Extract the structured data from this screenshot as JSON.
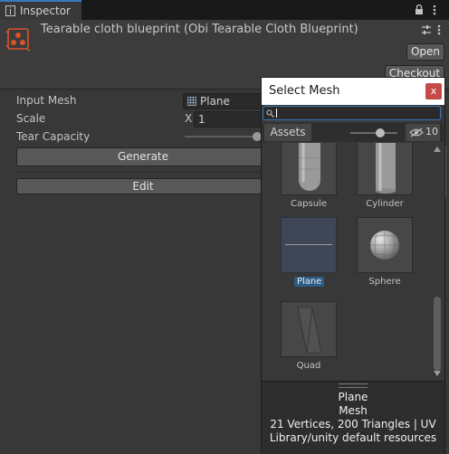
{
  "tab": {
    "title": "Inspector"
  },
  "header": {
    "title": "Tearable cloth blueprint (Obi Tearable Cloth Blueprint)",
    "open_label": "Open",
    "checkout_label": "Checkout"
  },
  "props": {
    "input_mesh_label": "Input Mesh",
    "input_mesh_value": "Plane",
    "scale_label": "Scale",
    "scale_axis": "X",
    "scale_value": "1",
    "tear_label": "Tear Capacity",
    "generate_label": "Generate",
    "edit_label": "Edit"
  },
  "popup": {
    "title": "Select Mesh",
    "close_label": "x",
    "search_value": "",
    "assets_tab": "Assets",
    "hidden_count": "10",
    "items": [
      {
        "label": "Capsule",
        "selected": false
      },
      {
        "label": "Cylinder",
        "selected": false
      },
      {
        "label": "Plane",
        "selected": true
      },
      {
        "label": "Sphere",
        "selected": false
      },
      {
        "label": "Quad",
        "selected": false
      }
    ],
    "preview": {
      "name": "Plane",
      "type": "Mesh",
      "stats": "21 Vertices, 200 Triangles | UV",
      "path": "Library/unity default resources"
    }
  }
}
